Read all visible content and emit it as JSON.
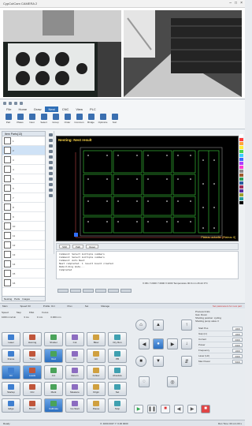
{
  "camera_window": {
    "title": "CypCutCam CAMERA 2"
  },
  "ribbon": {
    "tabs": [
      "File",
      "Home",
      "Draw",
      "Nest",
      "CNC",
      "View",
      "PLC"
    ],
    "active_tab": "Nest",
    "tools": [
      "Part",
      "Plates",
      "Nest",
      "Select",
      "Group",
      "Order",
      "Common",
      "Bridge",
      "Optimize",
      "Sort"
    ]
  },
  "parts": {
    "header": "Item Parts(13)",
    "items": [
      "1",
      "2",
      "3",
      "4",
      "5",
      "6",
      "7",
      "8",
      "9",
      "10",
      "11",
      "12",
      "13",
      "14",
      "15",
      "16"
    ],
    "bottom_tabs": [
      "Nesting",
      "Parts",
      "Images"
    ]
  },
  "canvas": {
    "title": "Nesting: Nest result",
    "status": "Plateau actuelle: [Plateau 8]"
  },
  "console": {
    "toolbar": [
      "Shift",
      "Path",
      "Reset"
    ],
    "lines": [
      "Command: Select multiple numbers",
      "Command: Select multiple numbers",
      "Command: Auto Nest",
      "Nest completed. 1 result board created",
      "Rebuilding mode...",
      "Completed"
    ],
    "coords": "X:451 Y:2000 Y:4900 X:1000 Temperature 00.9 mm  26.22 0°C"
  },
  "control": {
    "tabs": [
      "Main",
      "Speed Oil",
      "Profile: Oct",
      "Prev",
      "Set",
      "Manage"
    ],
    "warning": "Set parameters for new part",
    "params": [
      [
        "Speed",
        "Step",
        "Fillet",
        "Focus"
      ],
      [
        "1000 mm/min",
        "3 ms",
        "3 mm",
        "0.000 mm"
      ]
    ],
    "buttons": [
      "Laser",
      "Homing",
      "Shutter",
      "Cut",
      "Blow",
      "Dry Run",
      "Frame",
      "Trace",
      "Red",
      "Fil",
      "Hit",
      "PB",
      "Dir",
      "Leads",
      "Arc",
      "Return",
      "Follow",
      "Absolute",
      "Startup",
      "Circ",
      "Mark",
      "Measure",
      "Origin",
      "Set",
      "Edge",
      "Blow2",
      "Calibrate",
      "Go Start",
      "Pause",
      "Stop"
    ],
    "right_params": [
      [
        "Start Pos",
        "1000"
      ],
      [
        "Gap (m)",
        "1000"
      ],
      [
        "Current",
        "0000"
      ],
      [
        "Power",
        "0000"
      ],
      [
        "Frequency",
        "1000"
      ],
      [
        "Laser (Hz)",
        "0000"
      ],
      [
        "Max Power",
        "5000"
      ]
    ],
    "top_info": [
      "Process limits",
      "Gas: Room",
      "Shutting position: cycling",
      "Shutting pump valve 3"
    ]
  },
  "statusbar": {
    "left": "Ready",
    "middle": "X: 4000.0437 Y: 6.00 0000",
    "right": "Run Time: 00 min 00 s"
  }
}
